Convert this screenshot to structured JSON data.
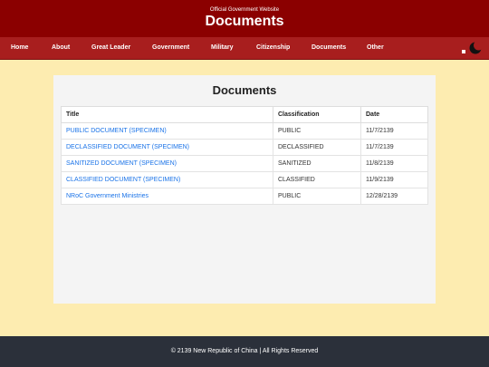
{
  "header": {
    "subtitle": "Official Government Website",
    "title": "Documents"
  },
  "nav": {
    "items": [
      {
        "label": "Home"
      },
      {
        "label": "About"
      },
      {
        "label": "Great Leader"
      },
      {
        "label": "Government"
      },
      {
        "label": "Military"
      },
      {
        "label": "Citizenship"
      },
      {
        "label": "Documents"
      },
      {
        "label": "Other"
      }
    ],
    "theme_toggle_icon": "moon-icon"
  },
  "main": {
    "heading": "Documents",
    "table": {
      "columns": [
        "Title",
        "Classification",
        "Date"
      ],
      "rows": [
        {
          "title": "PUBLIC DOCUMENT (SPECIMEN)",
          "classification": "PUBLIC",
          "date": "11/7/2139"
        },
        {
          "title": "DECLASSIFIED DOCUMENT (SPECIMEN)",
          "classification": "DECLASSIFIED",
          "date": "11/7/2139"
        },
        {
          "title": "SANITIZED DOCUMENT (SPECIMEN)",
          "classification": "SANITIZED",
          "date": "11/8/2139"
        },
        {
          "title": "CLASSIFIED DOCUMENT (SPECIMEN)",
          "classification": "CLASSIFIED",
          "date": "11/9/2139"
        },
        {
          "title": "NRoC Government Ministries",
          "classification": "PUBLIC",
          "date": "12/28/2139"
        }
      ]
    }
  },
  "footer": {
    "text": "© 2139 New Republic of China | All Rights Reserved"
  },
  "colors": {
    "header_bg": "#8b0000",
    "nav_bg": "#a81e1e",
    "page_bg": "#fdecb0",
    "link": "#1a73e8",
    "footer_bg": "#2b303a"
  }
}
